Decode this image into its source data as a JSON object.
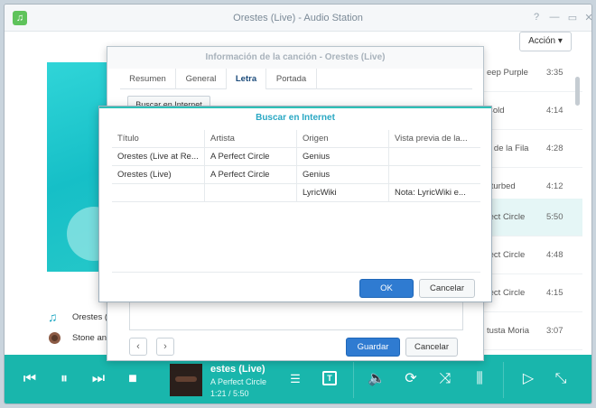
{
  "window": {
    "title": "Orestes (Live) - Audio Station",
    "action_label": "Acción",
    "app_icon": "music-note-icon"
  },
  "left_list": [
    {
      "label": "Orestes (Li",
      "icon": "music-note-icon"
    },
    {
      "label": "Stone and",
      "icon": "disc-icon"
    }
  ],
  "right_list": [
    {
      "title": "eep Purple",
      "duration": "3:35"
    },
    {
      "title": "Cold",
      "duration": "4:14"
    },
    {
      "title": "o de la Fila",
      "duration": "4:28"
    },
    {
      "title": "sturbed",
      "duration": "4:12"
    },
    {
      "title": "fect Circle",
      "duration": "5:50"
    },
    {
      "title": "fect Circle",
      "duration": "4:48"
    },
    {
      "title": "fect Circle",
      "duration": "4:15"
    },
    {
      "title": "tusta Moria",
      "duration": "3:07"
    }
  ],
  "song_info_dialog": {
    "title": "Información de la canción - Orestes (Live)",
    "tabs": [
      "Resumen",
      "General",
      "Letra",
      "Portada"
    ],
    "active_tab": "Letra",
    "search_button": "Buscar en Internet",
    "save_label": "Guardar",
    "cancel_label": "Cancelar",
    "prev_icon": "‹",
    "next_icon": "›"
  },
  "search_dialog": {
    "title": "Buscar en Internet",
    "columns": [
      "Título",
      "Artista",
      "Origen",
      "Vista previa de la..."
    ],
    "rows": [
      [
        "Orestes (Live at Re...",
        "A Perfect Circle",
        "Genius",
        ""
      ],
      [
        "Orestes (Live)",
        "A Perfect Circle",
        "Genius",
        ""
      ],
      [
        "",
        "",
        "LyricWiki",
        "Nota: LyricWiki e..."
      ]
    ],
    "ok_label": "OK",
    "cancel_label": "Cancelar"
  },
  "player": {
    "title": "estes (Live)",
    "artist": "A Perfect Circle",
    "time": "1:21 / 5:50",
    "lyrics_badge": "T",
    "accent": "#19b6ac"
  }
}
